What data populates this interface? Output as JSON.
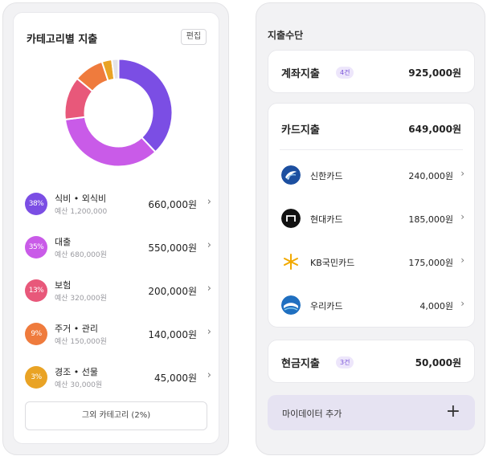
{
  "category": {
    "title": "카테고리별 지출",
    "edit_label": "편집",
    "items": [
      {
        "pct": "38%",
        "name": "식비 • 외식비",
        "budget": "예산 1,200,000",
        "amount": "660,000원",
        "color": "#7b4ee4",
        "value": 38
      },
      {
        "pct": "35%",
        "name": "대출",
        "budget": "예산 680,000원",
        "amount": "550,000원",
        "color": "#c95be8",
        "value": 35
      },
      {
        "pct": "13%",
        "name": "보험",
        "budget": "예산 320,000원",
        "amount": "200,000원",
        "color": "#e8587a",
        "value": 13
      },
      {
        "pct": "9%",
        "name": "주거 • 관리",
        "budget": "예산 150,000원",
        "amount": "140,000원",
        "color": "#ef7b3d",
        "value": 9
      },
      {
        "pct": "3%",
        "name": "경조 • 선물",
        "budget": "예산 30,000원",
        "amount": "45,000원",
        "color": "#e9a325",
        "value": 3
      }
    ],
    "other_value": 2,
    "other_color": "#e3e3e8",
    "other_label": "그외 카테고리 (2%)",
    "chevron": "›"
  },
  "payment": {
    "title": "지출수단",
    "account": {
      "label": "계좌지출",
      "count": "4건",
      "amount": "925,000원"
    },
    "card": {
      "label": "카드지출",
      "amount": "649,000원",
      "items": [
        {
          "name": "신한카드",
          "amount": "240,000원",
          "icon": "shinhan-logo-icon"
        },
        {
          "name": "현대카드",
          "amount": "185,000원",
          "icon": "hyundai-logo-icon"
        },
        {
          "name": "KB국민카드",
          "amount": "175,000원",
          "icon": "kb-logo-icon"
        },
        {
          "name": "우리카드",
          "amount": "4,000원",
          "icon": "woori-logo-icon"
        }
      ]
    },
    "cash": {
      "label": "현금지출",
      "count": "3건",
      "amount": "50,000원"
    },
    "add_label": "마이데이터 추가",
    "add_icon": "+"
  }
}
